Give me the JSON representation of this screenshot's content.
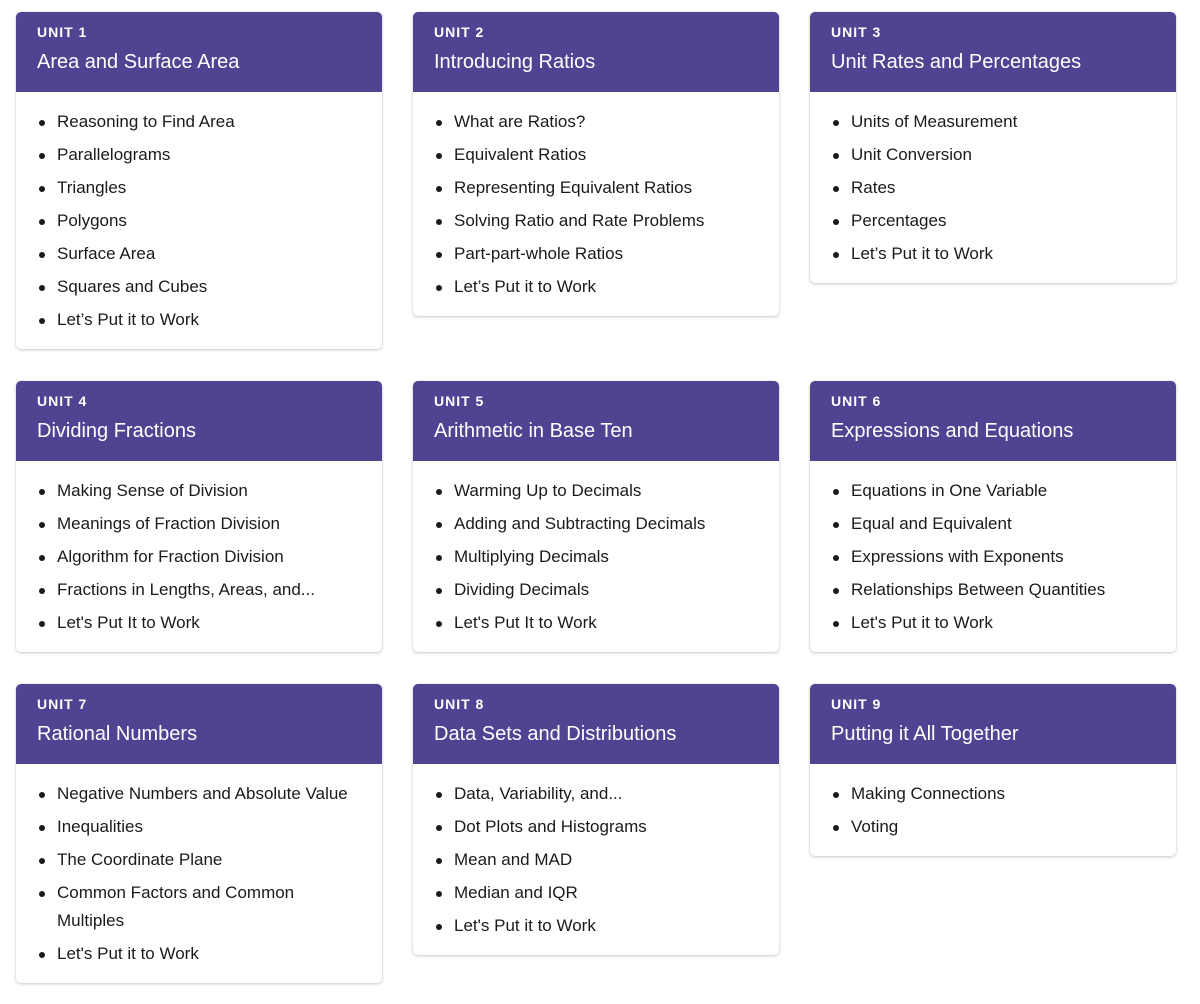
{
  "accent_color": "#4f4392",
  "units": [
    {
      "label": "UNIT 1",
      "title": "Area and Surface Area",
      "lessons": [
        "Reasoning to Find Area",
        "Parallelograms",
        "Triangles",
        "Polygons",
        "Surface Area",
        "Squares and Cubes",
        "Let’s Put it to Work"
      ]
    },
    {
      "label": "UNIT 2",
      "title": "Introducing Ratios",
      "lessons": [
        "What are Ratios?",
        "Equivalent Ratios",
        "Representing Equivalent Ratios",
        "Solving Ratio and Rate Problems",
        "Part-part-whole Ratios",
        "Let’s Put it to Work"
      ]
    },
    {
      "label": "UNIT 3",
      "title": "Unit Rates and Percentages",
      "lessons": [
        "Units of Measurement",
        "Unit Conversion",
        "Rates",
        "Percentages",
        "Let’s Put it to Work"
      ]
    },
    {
      "label": "UNIT 4",
      "title": "Dividing Fractions",
      "lessons": [
        "Making Sense of Division",
        "Meanings of Fraction Division",
        "Algorithm for Fraction Division",
        "Fractions in Lengths, Areas, and...",
        "Let's Put It to Work"
      ]
    },
    {
      "label": "UNIT 5",
      "title": "Arithmetic in Base Ten",
      "lessons": [
        "Warming Up to Decimals",
        "Adding and Subtracting Decimals",
        "Multiplying Decimals",
        "Dividing Decimals",
        "Let's Put It to Work"
      ]
    },
    {
      "label": "UNIT 6",
      "title": "Expressions and Equations",
      "lessons": [
        "Equations in One Variable",
        "Equal and Equivalent",
        "Expressions with Exponents",
        "Relationships Between Quantities",
        "Let's Put it to Work"
      ]
    },
    {
      "label": "UNIT 7",
      "title": "Rational Numbers",
      "lessons": [
        "Negative Numbers and Absolute Value",
        "Inequalities",
        "The Coordinate Plane",
        "Common Factors and Common Multiples",
        "Let's Put it to Work"
      ]
    },
    {
      "label": "UNIT 8",
      "title": "Data Sets and Distributions",
      "lessons": [
        "Data, Variability, and...",
        "Dot Plots and Histograms",
        "Mean and MAD",
        "Median and IQR",
        "Let's Put it to Work"
      ]
    },
    {
      "label": "UNIT 9",
      "title": "Putting it All Together",
      "lessons": [
        "Making Connections",
        "Voting"
      ]
    }
  ]
}
